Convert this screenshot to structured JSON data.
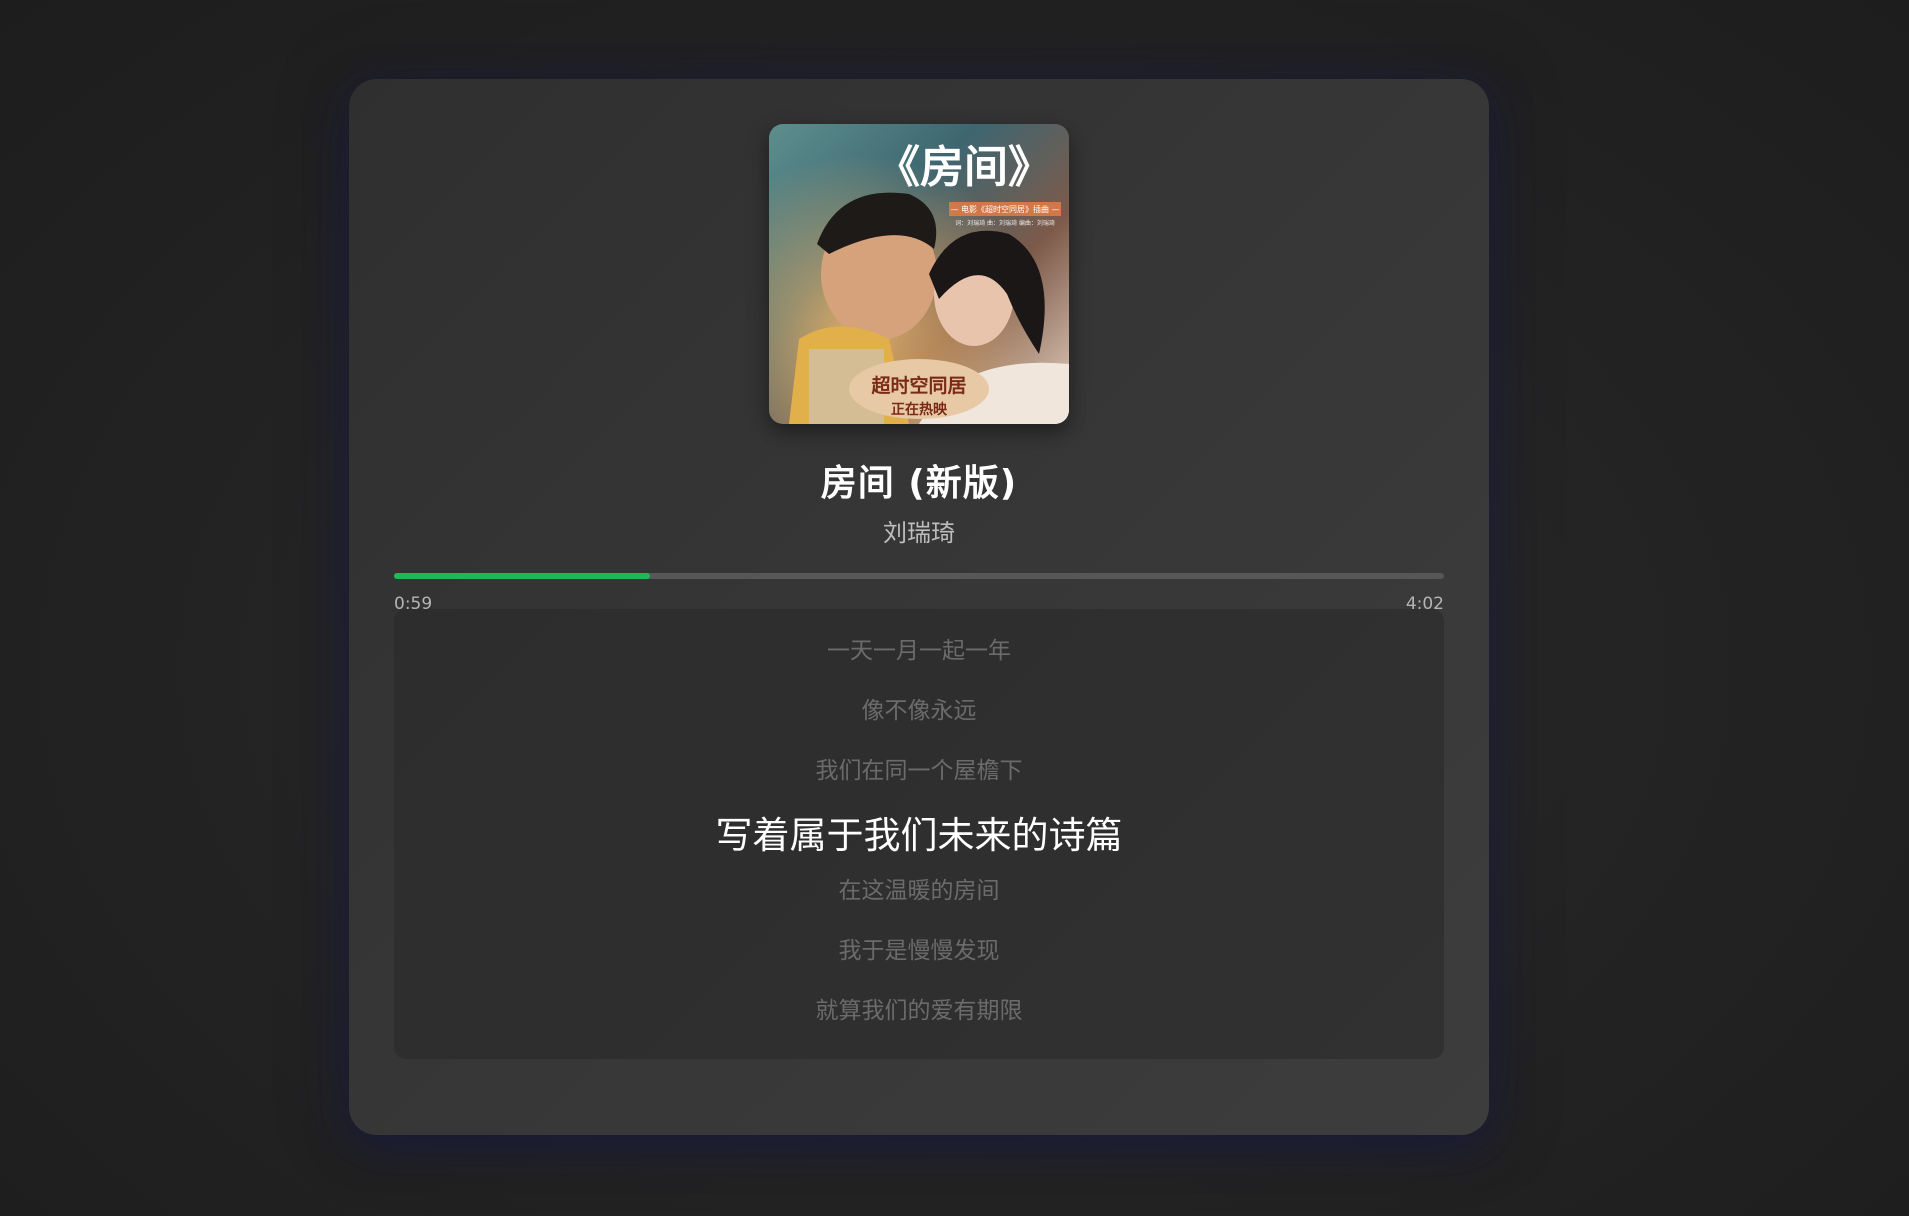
{
  "player": {
    "song_title": "房间 (新版)",
    "artist": "刘瑞琦",
    "current_time": "0:59",
    "total_time": "4:02",
    "progress_fraction": 0.2438,
    "accent_color": "#1db954"
  },
  "cover": {
    "title_text": "《房间》",
    "subtitle_text": "— 电影《超时空同居》插曲 —",
    "credits_text": "词：刘瑞琦 曲：刘瑞琦 编曲：刘瑞琦",
    "movie_name": "超时空同居",
    "tagline": "正在热映"
  },
  "lyrics": {
    "lines": [
      "一天一月一起一年",
      "像不像永远",
      "我们在同一个屋檐下",
      "写着属于我们未来的诗篇",
      "在这温暖的房间",
      "我于是慢慢发现",
      "就算我们的爱有期限"
    ],
    "active_index": 3
  }
}
